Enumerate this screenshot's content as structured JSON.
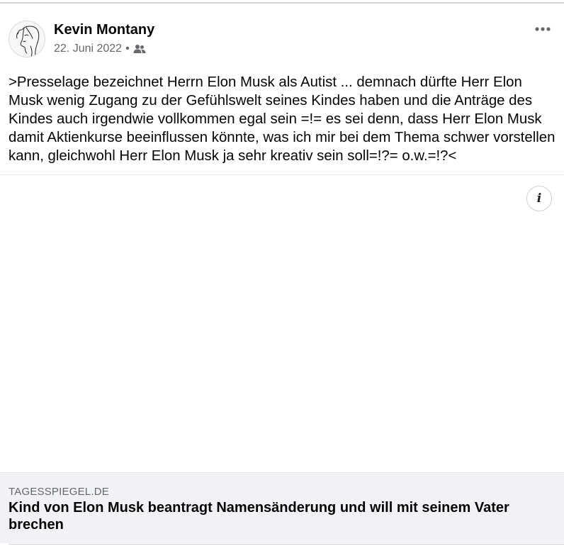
{
  "post": {
    "author_name": "Kevin Montany",
    "date": "22. Juni 2022",
    "separator": "•",
    "audience_icon": "friends-icon",
    "more_icon": "more-options-icon",
    "text": ">Presselage bezeichnet Herrn Elon Musk als Autist ... demnach dürfte Herr Elon Musk wenig Zugang zu der Gefühlswelt seines Kindes haben und die Anträge des Kindes auch irgendwie vollkommen egal sein =!= es sei denn, dass Herr Elon Musk damit Aktienkurse beeinflussen könnte, was ich mir bei dem Thema schwer vorstellen kann, gleichwohl Herr Elon Musk ja sehr kreativ sein soll=!?= o.w.=!?<",
    "info_icon": "info-icon",
    "info_glyph": "i"
  },
  "link": {
    "domain": "TAGESSPIEGEL.DE",
    "title": "Kind von Elon Musk beantragt Namensänderung und will mit seinem Vater brechen"
  },
  "colors": {
    "text_primary": "#050505",
    "text_secondary": "#65676b",
    "card_background": "#f0f2f5",
    "divider": "#e4e6eb"
  }
}
